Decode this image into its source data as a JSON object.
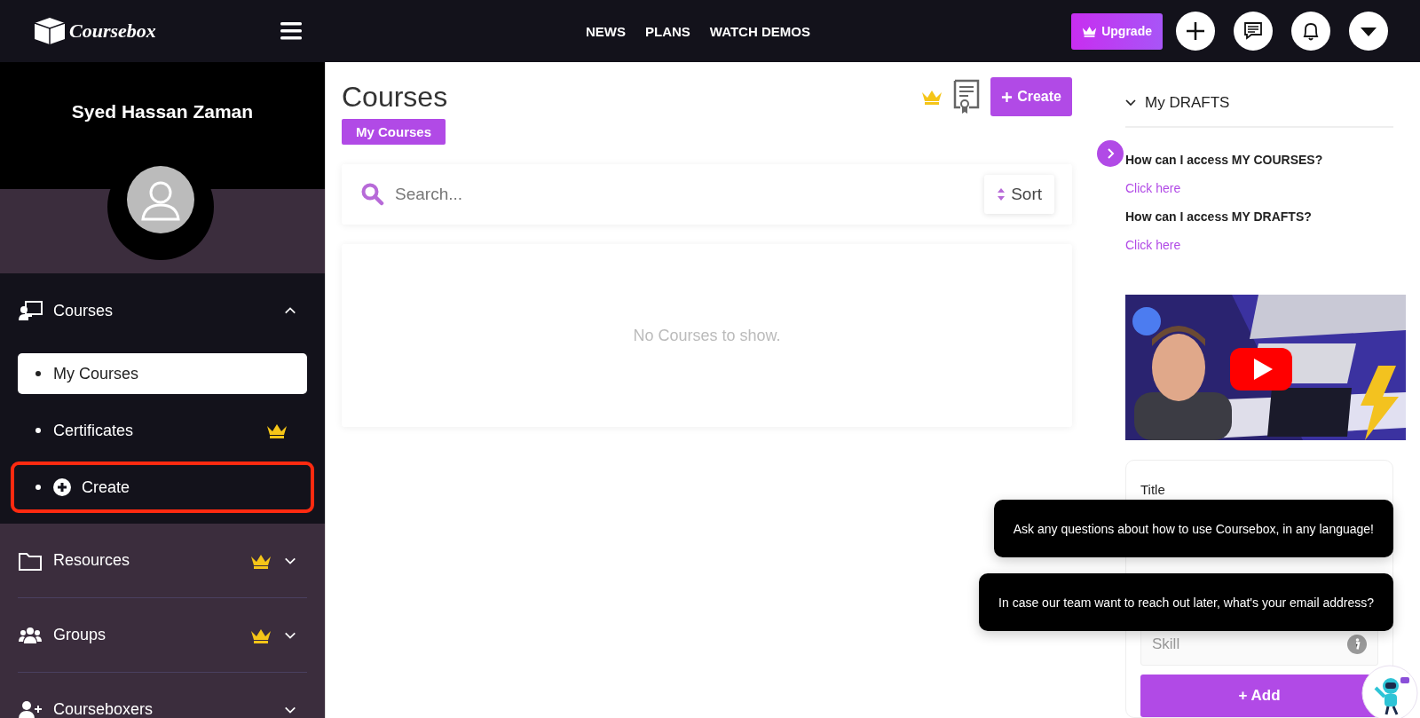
{
  "topbar": {
    "logo": "Coursebox",
    "nav": [
      "NEWS",
      "PLANS",
      "WATCH DEMOS"
    ],
    "upgrade": "Upgrade"
  },
  "profile": {
    "name": "Syed Hassan Zaman"
  },
  "sidebar": {
    "sections": [
      {
        "label": "Courses",
        "premium": false,
        "expanded": true,
        "children": [
          {
            "label": "My Courses",
            "selected": true,
            "premium": false,
            "plus": false,
            "highlighted": false
          },
          {
            "label": "Certificates",
            "selected": false,
            "premium": true,
            "plus": false,
            "highlighted": false
          },
          {
            "label": "Create",
            "selected": false,
            "premium": false,
            "plus": true,
            "highlighted": true
          }
        ]
      },
      {
        "label": "Resources",
        "premium": true,
        "expanded": false
      },
      {
        "label": "Groups",
        "premium": true,
        "expanded": false
      },
      {
        "label": "Courseboxers",
        "premium": false,
        "expanded": false
      }
    ]
  },
  "main": {
    "title": "Courses",
    "tab": "My Courses",
    "create": "Create",
    "search": {
      "placeholder": "Search..."
    },
    "sort": "Sort",
    "empty": "No Courses to show."
  },
  "drafts": {
    "title": "My DRAFTS",
    "expanded": true,
    "faq": [
      {
        "question": "How can I access MY COURSES?",
        "link": "Click here"
      },
      {
        "question": "How can I access MY DRAFTS?",
        "link": "Click here"
      }
    ]
  },
  "form": {
    "title_label": "Title",
    "skill": {
      "placeholder": "Skill"
    },
    "add": "+ Add"
  },
  "chat": {
    "messages": [
      "Ask any questions about how to use Coursebox, in any language!",
      "In case our team want to reach out later, what's your email address?"
    ]
  }
}
